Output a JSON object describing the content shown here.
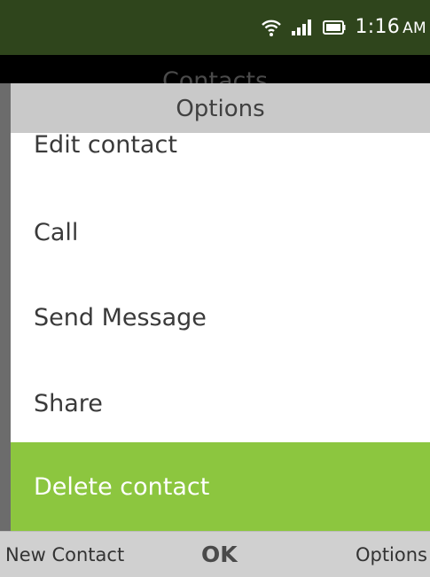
{
  "status_bar": {
    "time": "1:16",
    "ampm": "AM",
    "icons": [
      "wifi-icon",
      "signal-icon",
      "battery-icon"
    ]
  },
  "app": {
    "title": "Contacts"
  },
  "options_menu": {
    "title": "Options",
    "items": [
      {
        "label": "Edit contact"
      },
      {
        "label": "Call"
      },
      {
        "label": "Send Message"
      },
      {
        "label": "Share"
      },
      {
        "label": "Delete contact",
        "selected": true
      }
    ]
  },
  "softkeys": {
    "left": "New Contact",
    "center": "OK",
    "right": "Options"
  },
  "colors": {
    "status_bar_bg": "#2f451c",
    "selected_bg": "#8cc63f",
    "header_bg": "#c9c9c9",
    "softkey_bg": "#d0d0d0"
  }
}
